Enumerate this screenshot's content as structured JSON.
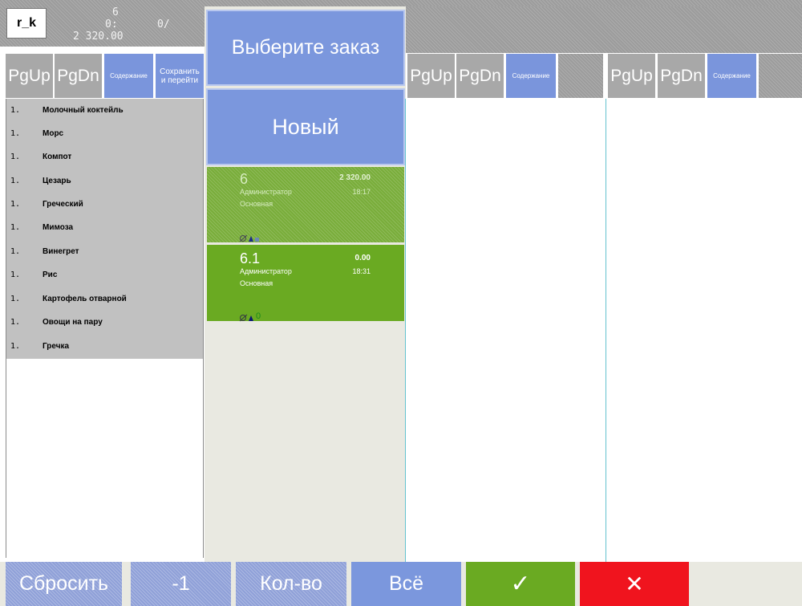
{
  "header": {
    "logo": "r_k",
    "line1": "6",
    "line2_a": "0:",
    "line2_b": "0/",
    "line3": "2 320.00"
  },
  "left_toolbar": {
    "pgup": "PgUp",
    "pgdn": "PgDn",
    "content": "Содержание",
    "save_go_1": "Сохранить",
    "save_go_2": "и перейти"
  },
  "menu_items": [
    {
      "qty": "1.",
      "name": "Молочный коктейль"
    },
    {
      "qty": "1.",
      "name": "Морс"
    },
    {
      "qty": "1.",
      "name": "Компот"
    },
    {
      "qty": "1.",
      "name": "Цезарь"
    },
    {
      "qty": "1.",
      "name": "Греческий"
    },
    {
      "qty": "1.",
      "name": "Мимоза"
    },
    {
      "qty": "1.",
      "name": "Винегрет"
    },
    {
      "qty": "1.",
      "name": "Рис"
    },
    {
      "qty": "1.",
      "name": "Картофель отварной"
    },
    {
      "qty": "1.",
      "name": "Овощи на пару"
    },
    {
      "qty": "1.",
      "name": "Гречка"
    }
  ],
  "middle": {
    "select_order": "Выберите заказ",
    "new": "Новый"
  },
  "orders": [
    {
      "number": "6",
      "sum": "2 320.00",
      "waiter": "Администратор",
      "time": "18:17",
      "hall": "Основная",
      "extra": ""
    },
    {
      "number": "6.1",
      "sum": "0.00",
      "waiter": "Администратор",
      "time": "18:31",
      "hall": "Основная",
      "extra": "0"
    }
  ],
  "right_toolbar_1": {
    "pgup": "PgUp",
    "pgdn": "PgDn",
    "content": "Содержание"
  },
  "right_toolbar_2": {
    "pgup": "PgUp",
    "pgdn": "PgDn",
    "content": "Содержание"
  },
  "bottom_bar": {
    "reset": "Сбросить",
    "minus_one": "-1",
    "qty": "Кол-во",
    "all": "Всё",
    "ok": "✓",
    "cancel": "✕"
  },
  "colors": {
    "blue": "#7b97dd",
    "green": "#6aaa22",
    "red": "#f0141e",
    "gray": "#a8a8a8",
    "teal_border": "#64c2cf"
  }
}
